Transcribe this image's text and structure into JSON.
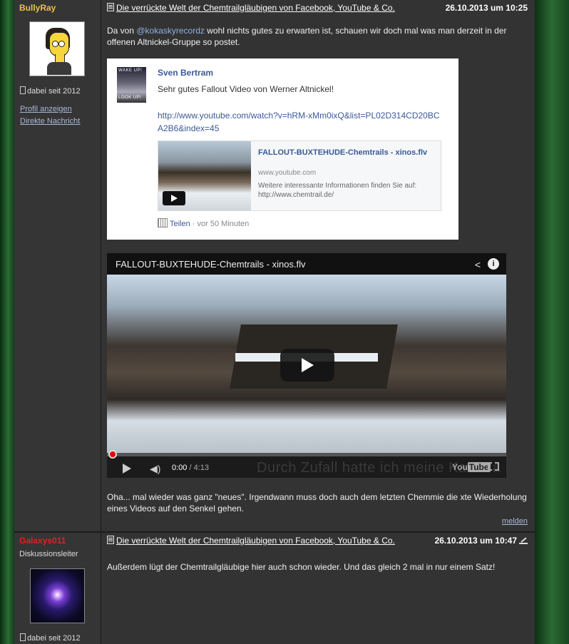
{
  "post1": {
    "author": "BullyRay",
    "member_since": "dabei seit 2012",
    "links": [
      "Profil anzeigen",
      "Direkte Nachricht"
    ],
    "topic": "Die verrückte Welt der Chemtrailgläubigen von Facebook, YouTube & Co.",
    "date": "26.10.2013 um 10:25",
    "intro_part1": "Da von ",
    "mention": "@kokaskyrecordz",
    "intro_part2": " wohl nichts gutes zu erwarten ist, schauen wir doch mal was man derzeit in der offenen Altnickel-Gruppe so postet.",
    "fb": {
      "thumb_top": "WAKE UP!",
      "thumb_bottom": "LOOK UP!",
      "name": "Sven Bertram",
      "message": "Sehr gutes Fallout Video von Werner Altnickel!",
      "url": "http://www.youtube.com/watch?v=hRM-xMm0ixQ&list=PL02D314CD20BCA2B6&index=45",
      "link_title": "FALLOUT-BUXTEHUDE-Chemtrails - xinos.flv",
      "link_domain": "www.youtube.com",
      "link_desc": "Weitere interessante Informationen finden Sie auf: http://www.chemtrail.de/",
      "share": "Teilen",
      "ago": " · vor 50 Minuten"
    },
    "video": {
      "title": "FALLOUT-BUXTEHUDE-Chemtrails - xinos.flv",
      "time": "0:00",
      "duration": " / 4:13",
      "overlay": "Durch Zufall hatte ich meine Kamera",
      "logo_you": "You",
      "logo_tube": "Tube",
      "progress": 0
    },
    "outro": "Oha... mal wieder was ganz \"neues\". Irgendwann muss doch auch dem letzten Chemmie die xte Wiederholung eines Videos auf den Senkel gehen.",
    "report": "melden"
  },
  "post2": {
    "author": "Galaxys011",
    "role": "Diskussionsleiter",
    "member_since": "dabei seit 2012",
    "topic": "Die verrückte Welt der Chemtrailgläubigen von Facebook, YouTube & Co.",
    "date": "26.10.2013 um 10:47",
    "text": "Außerdem lügt der Chemtrailgläubige hier auch schon wieder. Und das gleich 2 mal in nur einem Satz!"
  },
  "colors": {
    "page_bg": "#333333",
    "author1": "#e8c24a",
    "author2": "#e02020",
    "link": "#a9b8d8",
    "fb_blue": "#3b5998",
    "yt_red": "#e00000"
  }
}
